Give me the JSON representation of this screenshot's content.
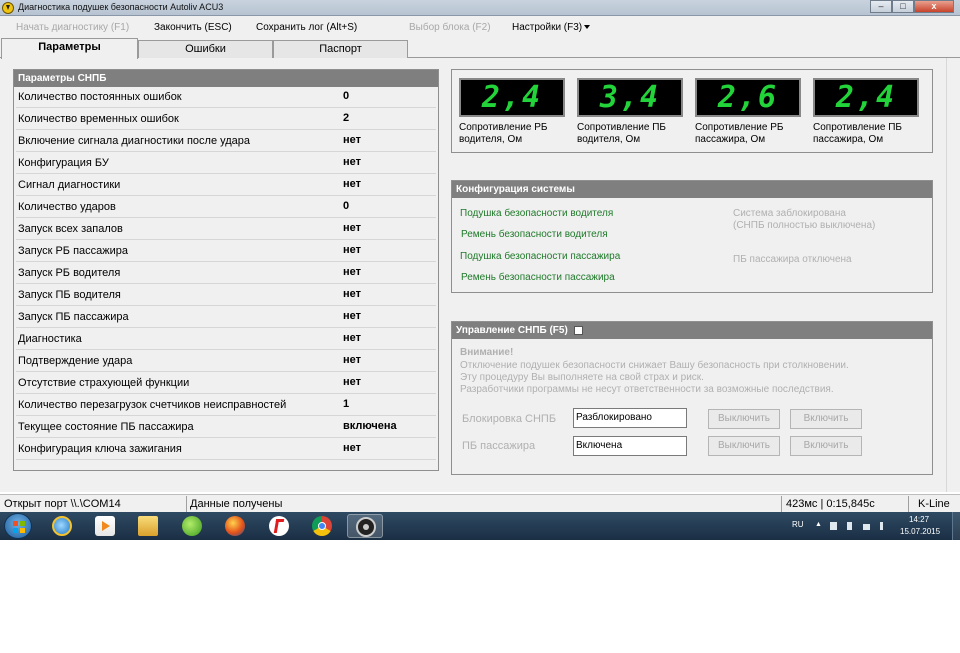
{
  "window": {
    "title": "Диагностика подушек безопасности Autoliv ACU3",
    "minimize": "–",
    "maximize": "□",
    "close": "x"
  },
  "menu": {
    "start_diag": "Начать диагностику (F1)",
    "finish": "Закончить (ESC)",
    "save_log": "Сохранить лог (Alt+S)",
    "select_block": "Выбор блока (F2)",
    "settings": "Настройки (F3)"
  },
  "tabs": [
    {
      "label": "Параметры"
    },
    {
      "label": "Ошибки"
    },
    {
      "label": "Паспорт"
    }
  ],
  "params": {
    "header": "Параметры СНПБ",
    "rows": [
      {
        "label": "Количество постоянных ошибок",
        "value": "0"
      },
      {
        "label": "Количество временных ошибок",
        "value": "2"
      },
      {
        "label": "Включение сигнала диагностики после удара",
        "value": "нет"
      },
      {
        "label": "Конфигурация БУ",
        "value": "нет"
      },
      {
        "label": "Сигнал диагностики",
        "value": "нет"
      },
      {
        "label": "Количество ударов",
        "value": "0"
      },
      {
        "label": "Запуск всех запалов",
        "value": "нет"
      },
      {
        "label": "Запуск РБ пассажира",
        "value": "нет"
      },
      {
        "label": "Запуск РБ водителя",
        "value": "нет"
      },
      {
        "label": "Запуск ПБ водителя",
        "value": "нет"
      },
      {
        "label": "Запуск ПБ пассажира",
        "value": "нет"
      },
      {
        "label": "Диагностика",
        "value": "нет"
      },
      {
        "label": "Подтверждение удара",
        "value": "нет"
      },
      {
        "label": "Отсутствие страхующей функции",
        "value": "нет"
      },
      {
        "label": "Количество перезагрузок счетчиков неисправностей",
        "value": "1"
      },
      {
        "label": "Текущее состояние ПБ пассажира",
        "value": "включена"
      },
      {
        "label": "Конфигурация ключа зажигания",
        "value": "нет"
      }
    ]
  },
  "displays": [
    {
      "value": "2,4",
      "label1": "Сопротивление РБ",
      "label2": "водителя, Ом"
    },
    {
      "value": "3,4",
      "label1": "Сопротивление ПБ",
      "label2": "водителя, Ом"
    },
    {
      "value": "2,6",
      "label1": "Сопротивление РБ",
      "label2": "пассажира, Ом"
    },
    {
      "value": "2,4",
      "label1": "Сопротивление ПБ",
      "label2": "пассажира, Ом"
    }
  ],
  "config": {
    "header": "Конфигурация системы",
    "green_items": [
      "Подушка безопасности водителя",
      "Ремень безопасности водителя",
      "Подушка безопасности пассажира",
      "Ремень безопасности пассажира"
    ],
    "system_locked_1": "Система заблокирована",
    "system_locked_2": "(СНПБ полностью выключена)",
    "passenger_off": "ПБ пассажира отключена"
  },
  "control": {
    "header": "Управление СНПБ (F5)",
    "warning_title": "Внимание!",
    "warning_lines": [
      "Отключение подушек безопасности снижает Вашу безопасность при столкновении.",
      "Эту процедуру Вы выполняете на свой страх и риск.",
      "Разработчики программы не несут ответственности за возможные последствия."
    ],
    "block_label": "Блокировка СНПБ",
    "block_value": "Разблокировано",
    "passenger_label": "ПБ пассажира",
    "passenger_value": "Включена",
    "off_button": "Выключить",
    "on_button": "Включить"
  },
  "statusbar": {
    "port": "Открыт порт \\\\.\\COM14",
    "data": "Данные получены",
    "timing": "423мс | 0:15,845с",
    "protocol": "K-Line"
  },
  "taskbar": {
    "lang": "RU",
    "time": "14:27",
    "date": "15.07.2015"
  }
}
